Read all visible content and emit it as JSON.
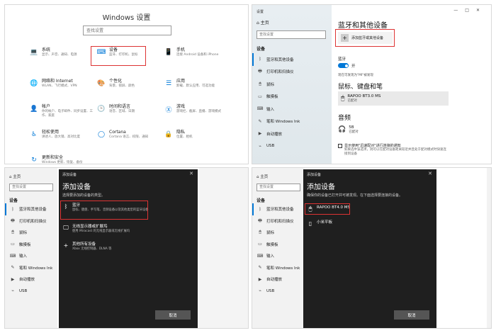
{
  "panel1": {
    "title": "Windows 设置",
    "search_placeholder": "查找设置",
    "tiles": [
      {
        "name": "系统",
        "desc": "显示、声音、通知、电源",
        "icon": "laptop-icon"
      },
      {
        "name": "设备",
        "desc": "蓝牙、打印机、鼠标",
        "icon": "keyboard-icon"
      },
      {
        "name": "手机",
        "desc": "连接 Android 设备和 iPhone",
        "icon": "phone-icon"
      },
      {
        "name": "网络和 Internet",
        "desc": "WLAN、飞行模式、VPN",
        "icon": "globe-icon"
      },
      {
        "name": "个性化",
        "desc": "背景、锁屏、颜色",
        "icon": "paint-icon"
      },
      {
        "name": "应用",
        "desc": "卸载、默认应用、可选功能",
        "icon": "apps-icon"
      },
      {
        "name": "帐户",
        "desc": "你的帐户、电子邮件、同步设置、工作、家庭",
        "icon": "person-icon"
      },
      {
        "name": "时间和语言",
        "desc": "语音、区域、日期",
        "icon": "clock-icon"
      },
      {
        "name": "游戏",
        "desc": "游戏栏、截屏、直播、游戏模式",
        "icon": "xbox-icon"
      },
      {
        "name": "轻松使用",
        "desc": "讲述人、放大镜、高对比度",
        "icon": "accessibility-icon"
      },
      {
        "name": "Cortana",
        "desc": "Cortana 语言、权限、通知",
        "icon": "cortana-icon"
      },
      {
        "name": "隐私",
        "desc": "位置、相机",
        "icon": "lock-icon"
      },
      {
        "name": "更新和安全",
        "desc": "Windows 更新、恢复、备份",
        "icon": "refresh-icon"
      }
    ]
  },
  "panel2": {
    "window_title": "设置",
    "home": "主页",
    "search_placeholder": "查找设置",
    "section": "设备",
    "nav": [
      {
        "label": "蓝牙和其他设备",
        "icon": "bluetooth-icon"
      },
      {
        "label": "打印机和扫描仪",
        "icon": "printer-icon"
      },
      {
        "label": "鼠标",
        "icon": "mouse-icon"
      },
      {
        "label": "触摸板",
        "icon": "touchpad-icon"
      },
      {
        "label": "输入",
        "icon": "keyboard-icon"
      },
      {
        "label": "笔和 Windows Ink",
        "icon": "pen-icon"
      },
      {
        "label": "自动播放",
        "icon": "autoplay-icon"
      },
      {
        "label": "USB",
        "icon": "usb-icon"
      }
    ],
    "page_title": "蓝牙和其他设备",
    "add_button": "添加蓝牙或其他设备",
    "bluetooth_label": "蓝牙",
    "toggle_state": "开",
    "discoverable_note": "现在可发现为\"MI\"被发现",
    "mouse_section": "鼠标、键盘和笔",
    "device_name": "RAPOO BT3.0 MS",
    "device_status": "已配对",
    "audio_section": "音频",
    "audio_device": "5B",
    "audio_status": "已配对",
    "checkbox_label": "显示使用\"迅速配对\"进行连接的通知",
    "checkbox_note": "如果选中该选项，则可以在配对设备距离较近并且处于配对模式时快速连接到设备"
  },
  "panel3": {
    "home": "主页",
    "search_placeholder": "查找设置",
    "section": "设备",
    "nav": [
      {
        "label": "蓝牙和其他设备",
        "icon": "bluetooth-icon"
      },
      {
        "label": "打印机和扫描仪",
        "icon": "printer-icon"
      },
      {
        "label": "鼠标",
        "icon": "mouse-icon"
      },
      {
        "label": "触摸板",
        "icon": "touchpad-icon"
      },
      {
        "label": "输入",
        "icon": "keyboard-icon"
      },
      {
        "label": "笔和 Windows Ink",
        "icon": "pen-icon"
      },
      {
        "label": "自动播放",
        "icon": "autoplay-icon"
      },
      {
        "label": "USB",
        "icon": "usb-icon"
      }
    ],
    "dialog_header": "添加设备",
    "dialog_title": "添加设备",
    "dialog_subtitle": "选择要添加的设备的类型。",
    "options": [
      {
        "name": "蓝牙",
        "desc": "鼠标、键盘、手写笔、音频设备以及其他类型的蓝牙设备",
        "icon": "bluetooth-icon"
      },
      {
        "name": "无线显示器或扩展坞",
        "desc": "使用 Miracast 的无线显示器或无线扩展坞",
        "icon": "monitor-icon"
      },
      {
        "name": "其他所有设备",
        "desc": "Xbox 无线控制器、DLNA 等",
        "icon": "plus-icon"
      }
    ],
    "cancel": "取消"
  },
  "panel4": {
    "home": "主页",
    "search_placeholder": "查找设置",
    "section": "设备",
    "nav": [
      {
        "label": "蓝牙和其他设备",
        "icon": "bluetooth-icon"
      },
      {
        "label": "打印机和扫描仪",
        "icon": "printer-icon"
      },
      {
        "label": "鼠标",
        "icon": "mouse-icon"
      },
      {
        "label": "触摸板",
        "icon": "touchpad-icon"
      },
      {
        "label": "输入",
        "icon": "keyboard-icon"
      },
      {
        "label": "笔和 Windows Ink",
        "icon": "pen-icon"
      },
      {
        "label": "自动播放",
        "icon": "autoplay-icon"
      },
      {
        "label": "USB",
        "icon": "usb-icon"
      }
    ],
    "dialog_header": "添加设备",
    "dialog_title": "添加设备",
    "dialog_subtitle": "确保你的设备已打开并可被发现。在下面选择要连接的设备。",
    "devices": [
      {
        "name": "RAPOO BT4.0 MS",
        "icon": "mouse-icon"
      },
      {
        "name": "小米平板",
        "icon": "tablet-icon"
      }
    ],
    "cancel": "取消"
  },
  "colors": {
    "accent": "#0078d7",
    "highlight": "#dd3333",
    "dialog_bg": "#1f1f1f"
  }
}
